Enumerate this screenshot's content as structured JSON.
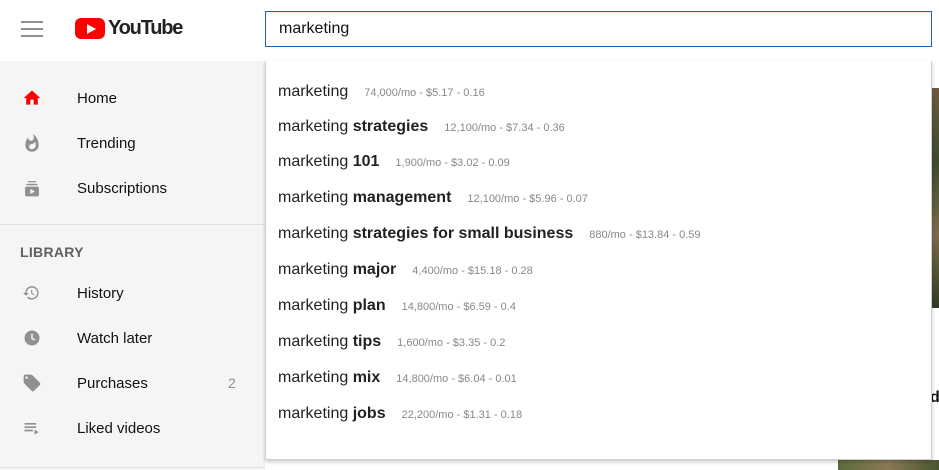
{
  "app": {
    "logo_text": "YouTube",
    "accent_color": "#ff0000",
    "focus_color": "#1c62b9"
  },
  "search": {
    "value": "marketing"
  },
  "sidebar": {
    "items": [
      {
        "label": "Home",
        "icon": "home-icon",
        "active": true
      },
      {
        "label": "Trending",
        "icon": "flame-icon"
      },
      {
        "label": "Subscriptions",
        "icon": "subscriptions-icon"
      }
    ],
    "library_title": "LIBRARY",
    "library_items": [
      {
        "label": "History",
        "icon": "history-icon"
      },
      {
        "label": "Watch later",
        "icon": "clock-icon"
      },
      {
        "label": "Purchases",
        "icon": "tag-icon",
        "count": "2"
      },
      {
        "label": "Liked videos",
        "icon": "playlist-icon"
      }
    ]
  },
  "suggestions": [
    {
      "base": "marketing",
      "bold": "",
      "meta": "74,000/mo - $5.17 - 0.16"
    },
    {
      "base": "marketing ",
      "bold": "strategies",
      "meta": "12,100/mo - $7.34 - 0.36"
    },
    {
      "base": "marketing ",
      "bold": "101",
      "meta": "1,900/mo - $3.02 - 0.09"
    },
    {
      "base": "marketing ",
      "bold": "management",
      "meta": "12,100/mo - $5.96 - 0.07"
    },
    {
      "base": "marketing ",
      "bold": "strategies for small business",
      "meta": "880/mo - $13.84 - 0.59"
    },
    {
      "base": "marketing ",
      "bold": "major",
      "meta": "4,400/mo - $15.18 - 0.28"
    },
    {
      "base": "marketing ",
      "bold": "plan",
      "meta": "14,800/mo - $6.59 - 0.4"
    },
    {
      "base": "marketing ",
      "bold": "tips",
      "meta": "1,600/mo - $3.35 - 0.2"
    },
    {
      "base": "marketing ",
      "bold": "mix",
      "meta": "14,800/mo - $6.04 - 0.01"
    },
    {
      "base": "marketing ",
      "bold": "jobs",
      "meta": "22,200/mo - $1.31 - 0.18"
    }
  ],
  "page_edge": {
    "partial_text": "d"
  }
}
